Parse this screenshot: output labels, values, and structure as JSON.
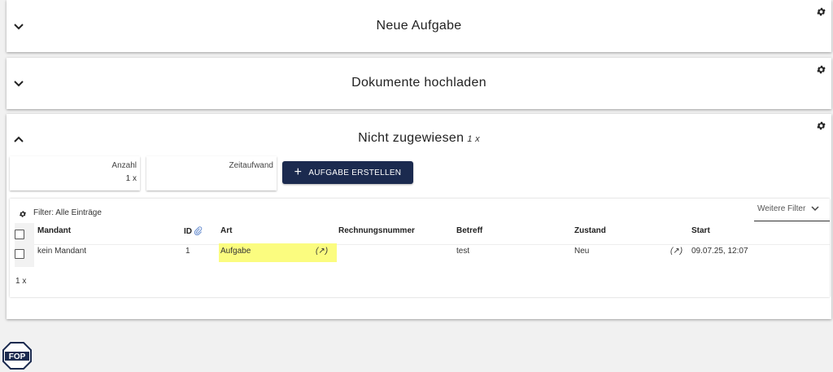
{
  "panels": {
    "neue_aufgabe": {
      "title": "Neue Aufgabe"
    },
    "dokumente": {
      "title": "Dokumente hochladen"
    },
    "nicht_zugewiesen": {
      "title": "Nicht zugewiesen",
      "count": "1 x"
    }
  },
  "stats": {
    "anzahl": {
      "label": "Anzahl",
      "value": "1 x"
    },
    "zeitaufwand": {
      "label": "Zeitaufwand",
      "value": ""
    }
  },
  "create_button": {
    "icon": "+",
    "label": "AUFGABE ERSTELLEN"
  },
  "table": {
    "filter_label": "Filter: Alle Einträge",
    "more_filters": "Weitere Filter",
    "columns": {
      "mandant": "Mandant",
      "id": "ID",
      "art": "Art",
      "rechnungsnummer": "Rechnungsnummer",
      "betreff": "Betreff",
      "zustand": "Zustand",
      "start": "Start"
    },
    "rows": [
      {
        "mandant": "kein Mandant",
        "id": "1",
        "art": "Aufgabe",
        "art_edit": "(↗)",
        "rechnungsnummer": "",
        "betreff": "test",
        "zustand": "Neu",
        "zustand_edit": "(↗)",
        "start": "09.07.25, 12:07"
      }
    ],
    "count": "1 x"
  },
  "colors": {
    "button_bg": "#1b2a4f",
    "highlight": "#fbfc7f",
    "background": "#f1f1f1"
  },
  "logo": {
    "text": "FOP"
  }
}
